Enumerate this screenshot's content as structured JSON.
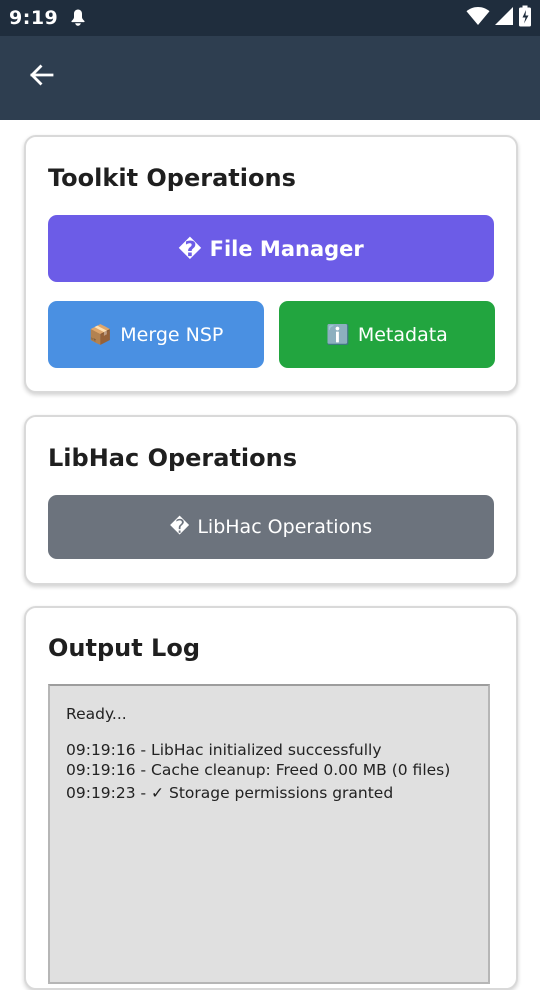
{
  "status_bar": {
    "time": "9:19",
    "left_icon": "notification-icon",
    "right_icons": [
      "wifi-icon",
      "signal-icon",
      "battery-icon"
    ]
  },
  "app_bar": {
    "back_icon": "arrow-back-icon"
  },
  "toolkit": {
    "title": "Toolkit Operations",
    "file_manager": {
      "glyph": "�",
      "label": "File Manager"
    },
    "merge_nsp": {
      "glyph": "📦",
      "label": "Merge NSP"
    },
    "metadata": {
      "glyph": "ℹ️",
      "label": "Metadata"
    }
  },
  "libhac": {
    "title": "LibHac Operations",
    "button": {
      "glyph": "�",
      "label": "LibHac Operations"
    }
  },
  "output": {
    "title": "Output Log",
    "lines": [
      "Ready...",
      "09:19:16 - LibHac initialized successfully",
      "09:19:16 - Cache cleanup: Freed 0.00 MB (0 files)",
      "09:19:23 - ✓ Storage permissions granted"
    ]
  },
  "colors": {
    "status_bar": "#1f2d3d",
    "app_bar": "#2e3e50",
    "file_manager": "#6c5ce7",
    "merge_nsp": "#4a90e2",
    "metadata": "#22a53f",
    "libhac": "#6c737d",
    "log_background": "#e0e0e0"
  }
}
